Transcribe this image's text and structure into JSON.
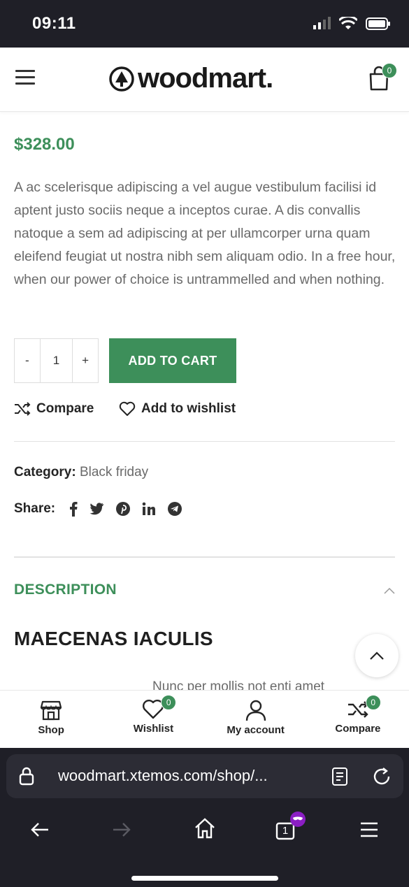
{
  "status_bar": {
    "time": "09:11"
  },
  "header": {
    "logo_text": "woodmart.",
    "cart_count": "0"
  },
  "product": {
    "price": "$328.00",
    "description": "A ac scelerisque adipiscing a vel augue vestibulum facilisi id aptent justo sociis neque a inceptos curae. A dis convallis natoque a sem ad adipiscing at per ullamcorper urna quam eleifend feugiat ut nostra nibh sem aliquam odio. In a free hour, when our power of choice is untrammelled and when nothing.",
    "qty_minus": "-",
    "quantity": "1",
    "qty_plus": "+",
    "add_to_cart": "ADD TO CART",
    "compare": "Compare",
    "wishlist": "Add to wishlist",
    "category_label": "Category:",
    "category_value": "Black friday",
    "share_label": "Share:"
  },
  "tabs": {
    "description": "DESCRIPTION"
  },
  "content": {
    "heading": "MAECENAS IACULIS",
    "cut_text": "Nunc per mollis not enti amet"
  },
  "bottom_nav": {
    "items": [
      {
        "label": "Shop"
      },
      {
        "label": "Wishlist",
        "count": "0"
      },
      {
        "label": "My account"
      },
      {
        "label": "Compare",
        "count": "0"
      }
    ]
  },
  "browser": {
    "url": "woodmart.xtemos.com/shop/...",
    "tab_count": "1"
  },
  "colors": {
    "accent": "#3d8f5a",
    "dark": "#1f1f27"
  }
}
